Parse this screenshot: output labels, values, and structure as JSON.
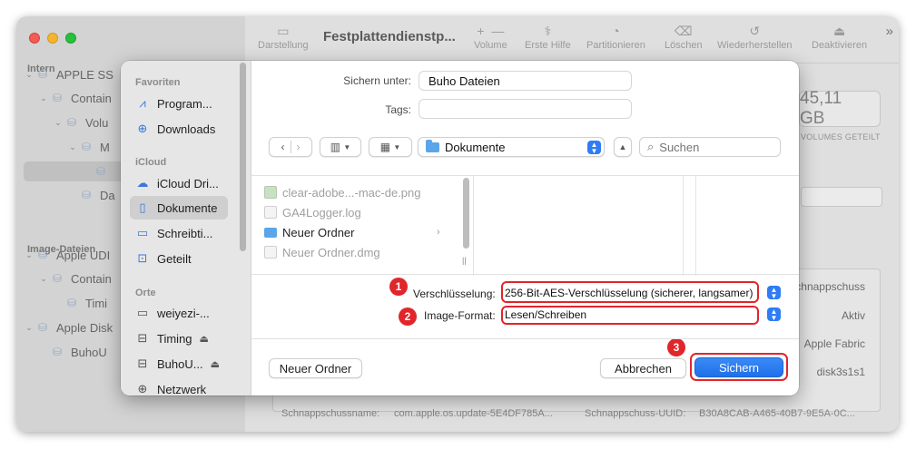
{
  "background_window": {
    "sidebar": {
      "section_intern": "Intern",
      "section_image": "Image-Dateien",
      "rows": [
        {
          "label": "APPLE SS",
          "indent": 0
        },
        {
          "label": "Contain",
          "indent": 1
        },
        {
          "label": "Volu",
          "indent": 2
        },
        {
          "label": "M",
          "indent": 3
        },
        {
          "label": "",
          "indent": 4
        },
        {
          "label": "Da",
          "indent": 3
        },
        {
          "label": "Apple UDI",
          "indent": 0
        },
        {
          "label": "Contain",
          "indent": 1
        },
        {
          "label": "Timi",
          "indent": 2
        },
        {
          "label": "Apple Disk",
          "indent": 0
        },
        {
          "label": "BuhoU",
          "indent": 1
        }
      ]
    },
    "toolbar": {
      "view_label": "Darstellung",
      "title": "Festplattendienstp...",
      "volume_label": "Volume",
      "first_aid_label": "Erste Hilfe",
      "partition_label": "Partitionieren",
      "erase_label": "Löschen",
      "restore_label": "Wiederherstellen",
      "deactivate_label": "Deaktivieren"
    },
    "capacity": "45,11 GB",
    "capacity_caption": "VOLUMES GETEILT",
    "info_values": [
      "chnappschuss",
      "Aktiv",
      "Apple Fabric",
      "disk3s1s1"
    ],
    "footer_name_label": "Schnappschussname:",
    "footer_name_value": "com.apple.os.update-5E4DF785A...",
    "footer_uuid_label": "Schnappschuss-UUID:",
    "footer_uuid_value": "B30A8CAB-A465-40B7-9E5A-0C..."
  },
  "sheet": {
    "sidebar": {
      "favorites_head": "Favoriten",
      "favorites": [
        {
          "label": "Program...",
          "icon": "apps-icon"
        },
        {
          "label": "Downloads",
          "icon": "download-icon"
        }
      ],
      "icloud_head": "iCloud",
      "icloud": [
        {
          "label": "iCloud Dri...",
          "icon": "cloud-icon"
        },
        {
          "label": "Dokumente",
          "icon": "document-icon",
          "selected": true
        },
        {
          "label": "Schreibti...",
          "icon": "desktop-icon"
        },
        {
          "label": "Geteilt",
          "icon": "shared-folder-icon"
        }
      ],
      "places_head": "Orte",
      "places": [
        {
          "label": "weiyezi-...",
          "icon": "computer-icon"
        },
        {
          "label": "Timing",
          "icon": "drive-icon",
          "eject": true
        },
        {
          "label": "BuhoU...",
          "icon": "drive-icon",
          "eject": true
        },
        {
          "label": "Netzwerk",
          "icon": "globe-icon"
        }
      ]
    },
    "save_as_label": "Sichern unter:",
    "save_as_value": "Buho Dateien",
    "tags_label": "Tags:",
    "tags_value": "",
    "location": "Dokumente",
    "search_placeholder": "Suchen",
    "files": [
      {
        "name": "clear-adobe...-mac-de.png",
        "type": "png",
        "enabled": false
      },
      {
        "name": "GA4Logger.log",
        "type": "doc",
        "enabled": false
      },
      {
        "name": "Neuer Ordner",
        "type": "folder",
        "enabled": true
      },
      {
        "name": "Neuer Ordner.dmg",
        "type": "doc",
        "enabled": false
      }
    ],
    "encryption_label": "Verschlüsselung:",
    "encryption_value": "256-Bit-AES-Verschlüsselung (sicherer, langsamer)",
    "format_label": "Image-Format:",
    "format_value": "Lesen/Schreiben",
    "new_folder_label": "Neuer Ordner",
    "cancel_label": "Abbrechen",
    "save_label": "Sichern",
    "badges": [
      "1",
      "2",
      "3"
    ]
  },
  "colors": {
    "accent": "#2f7cf6",
    "annotation_red": "#e0262b"
  }
}
